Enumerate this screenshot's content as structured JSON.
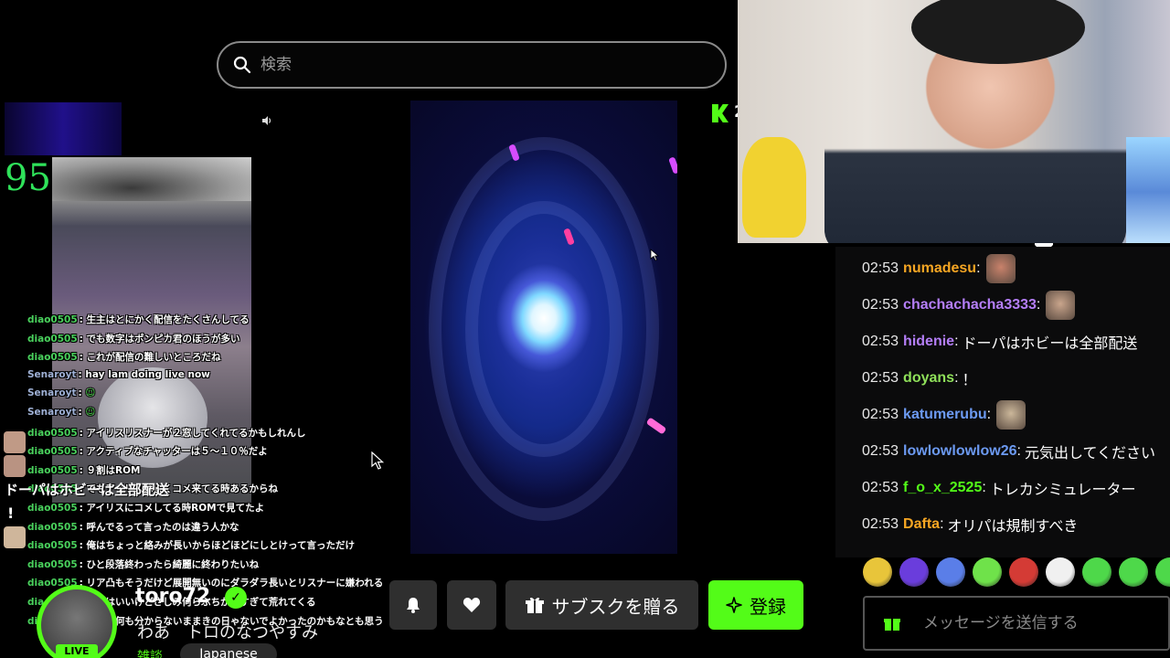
{
  "search": {
    "placeholder": "検索"
  },
  "overlay": {
    "counter": "95",
    "ticker": "ドーパはホビーは全部配送",
    "exclaim": "!",
    "chat": [
      {
        "user": "diao0505",
        "text": "生主はとにかく配信をたくさんしてる"
      },
      {
        "user": "diao0505",
        "text": "でも数字はポンピカ君のほうが多い"
      },
      {
        "user": "diao0505",
        "text": "これが配信の難しいところだね"
      },
      {
        "user": "Senaroyt",
        "text": "hay Iam doing live now"
      },
      {
        "user": "Senaroyt",
        "text": "☺"
      },
      {
        "user": "Senaroyt",
        "text": "☺"
      },
      {
        "user": "diao0505",
        "text": "アイリスリスナーが２窓してくれてるかもしれんし"
      },
      {
        "user": "diao0505",
        "text": "アクティブなチャッターは５〜１０％だよ"
      },
      {
        "user": "diao0505",
        "text": "９割はROM"
      },
      {
        "user": "diao0505",
        "text": "でもアイリスはよくコメ来てる時あるからね"
      },
      {
        "user": "diao0505",
        "text": "アイリスにコメしてる時ROMで見てたよ"
      },
      {
        "user": "diao0505",
        "text": "呼んでるって言ったのは違う人かな"
      },
      {
        "user": "diao0505",
        "text": "俺はちょっと絡みが長いからほどほどにしとけって言っただけ"
      },
      {
        "user": "diao0505",
        "text": "ひと段落終わったら綺麗に終わりたいね"
      },
      {
        "user": "diao0505",
        "text": "リア凸もそうだけど展開無いのにダラダラ長いとリスナーに嫌われる"
      },
      {
        "user": "diao0505",
        "text": "最近はいいけどさしみ何らぶちが多すぎて荒れてくる"
      },
      {
        "user": "diao0505",
        "text": "だから何も分からないままきの日ゃないでよかったのかもなとも思う"
      }
    ]
  },
  "kick_extra": "2",
  "chat": {
    "messages": [
      {
        "time": "02:53",
        "user": "numadesu",
        "sep": ":",
        "text": "",
        "color": "#f6a623",
        "emote": true,
        "emote_color": "#c9826b"
      },
      {
        "time": "02:53",
        "user": "chachachacha3333",
        "sep": ":",
        "text": "",
        "color": "#b47ef7",
        "emote": true,
        "emote_color": "#c9a58c"
      },
      {
        "time": "02:53",
        "user": "hidenie",
        "sep": ":",
        "text": "ドーパはホビーは全部配送",
        "color": "#b47ef7",
        "emote": false
      },
      {
        "time": "02:53",
        "user": "doyans",
        "sep": ":",
        "text": "！",
        "color": "#8fe05a",
        "emote": false
      },
      {
        "time": "02:53",
        "user": "katumerubu",
        "sep": ":",
        "text": "",
        "color": "#6c9af2",
        "emote": true,
        "emote_color": "#cbb79a"
      },
      {
        "time": "02:53",
        "user": "lowlowlowlow26",
        "sep": ":",
        "text": "元気出してください",
        "color": "#6c9af2",
        "emote": false
      },
      {
        "time": "02:53",
        "user": "f_o_x_2525",
        "sep": ":",
        "text": "トレカシミュレーター",
        "color": "#53fc18",
        "emote": false
      },
      {
        "time": "02:53",
        "user": "Dafta",
        "sep": ":",
        "text": "オリパは規制すべき",
        "color": "#f6a623",
        "emote": false
      }
    ],
    "input_placeholder": "メッセージを送信する"
  },
  "emotes": [
    "#e8c53a",
    "#6a3ddc",
    "#5a7ee8",
    "#6fe24a",
    "#d43b35",
    "#f0f0f0",
    "#4ed84a",
    "#4ed84a",
    "#4ed84a"
  ],
  "streamer": {
    "name": "toro72",
    "title": "わあ　トロのなつやすみ",
    "category": "雑談",
    "language": "Japanese",
    "live_label": "LIVE",
    "verified_icon": "✓"
  },
  "actions": {
    "gift_sub": "サブスクを贈る",
    "subscribe": "登録"
  },
  "colors": {
    "accent": "#53fc18",
    "button_dark": "#2f2f2f"
  }
}
